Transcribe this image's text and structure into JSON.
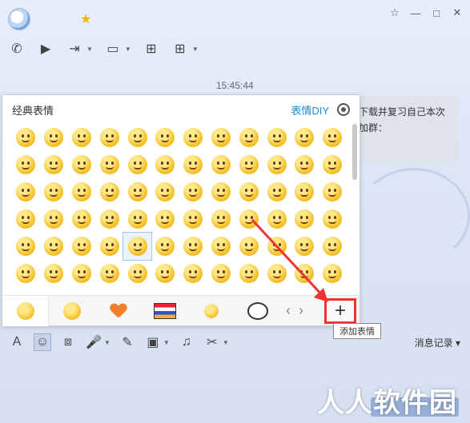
{
  "window": {
    "controls": [
      "☆",
      "—",
      "□",
      "✕"
    ]
  },
  "header": {
    "vip_star": "★"
  },
  "top_toolbar": [
    {
      "name": "phone-icon",
      "glyph": "✆"
    },
    {
      "name": "video-icon",
      "glyph": "▶"
    },
    {
      "name": "file-transfer-icon",
      "glyph": "⇥"
    },
    {
      "name": "screen-share-icon",
      "glyph": "▭"
    },
    {
      "name": "whiteboard-icon",
      "glyph": "⊞"
    },
    {
      "name": "apps-icon",
      "glyph": "⊞"
    }
  ],
  "chat": {
    "timestamp": "15:45:44",
    "bubble_lines": [
      "下载并复习自己本次",
      "加群："
    ]
  },
  "emoji_panel": {
    "title": "经典表情",
    "diy_label": "表情DIY",
    "rows": 6,
    "cols": 12,
    "hovered_index": 52,
    "tabs": [
      "classic-face",
      "yellow-face",
      "heart",
      "flag-sticker",
      "cartoon",
      "panda"
    ],
    "add_button": "+",
    "tooltip": "添加表情"
  },
  "bottom_toolbar": {
    "items": [
      {
        "name": "font-icon",
        "glyph": "A"
      },
      {
        "name": "emoji-icon",
        "glyph": "☺"
      },
      {
        "name": "shake-icon",
        "glyph": "⧈"
      },
      {
        "name": "voice-icon",
        "glyph": "🎤"
      },
      {
        "name": "pen-icon",
        "glyph": "✎"
      },
      {
        "name": "image-icon",
        "glyph": "▣"
      },
      {
        "name": "music-icon",
        "glyph": "♫"
      },
      {
        "name": "scissors-icon",
        "glyph": "✂"
      }
    ],
    "history_label": "消息记录 ▾"
  },
  "watermark": "人人软件园",
  "colors": {
    "accent": "#1e88d6",
    "highlight_red": "#e33333"
  }
}
